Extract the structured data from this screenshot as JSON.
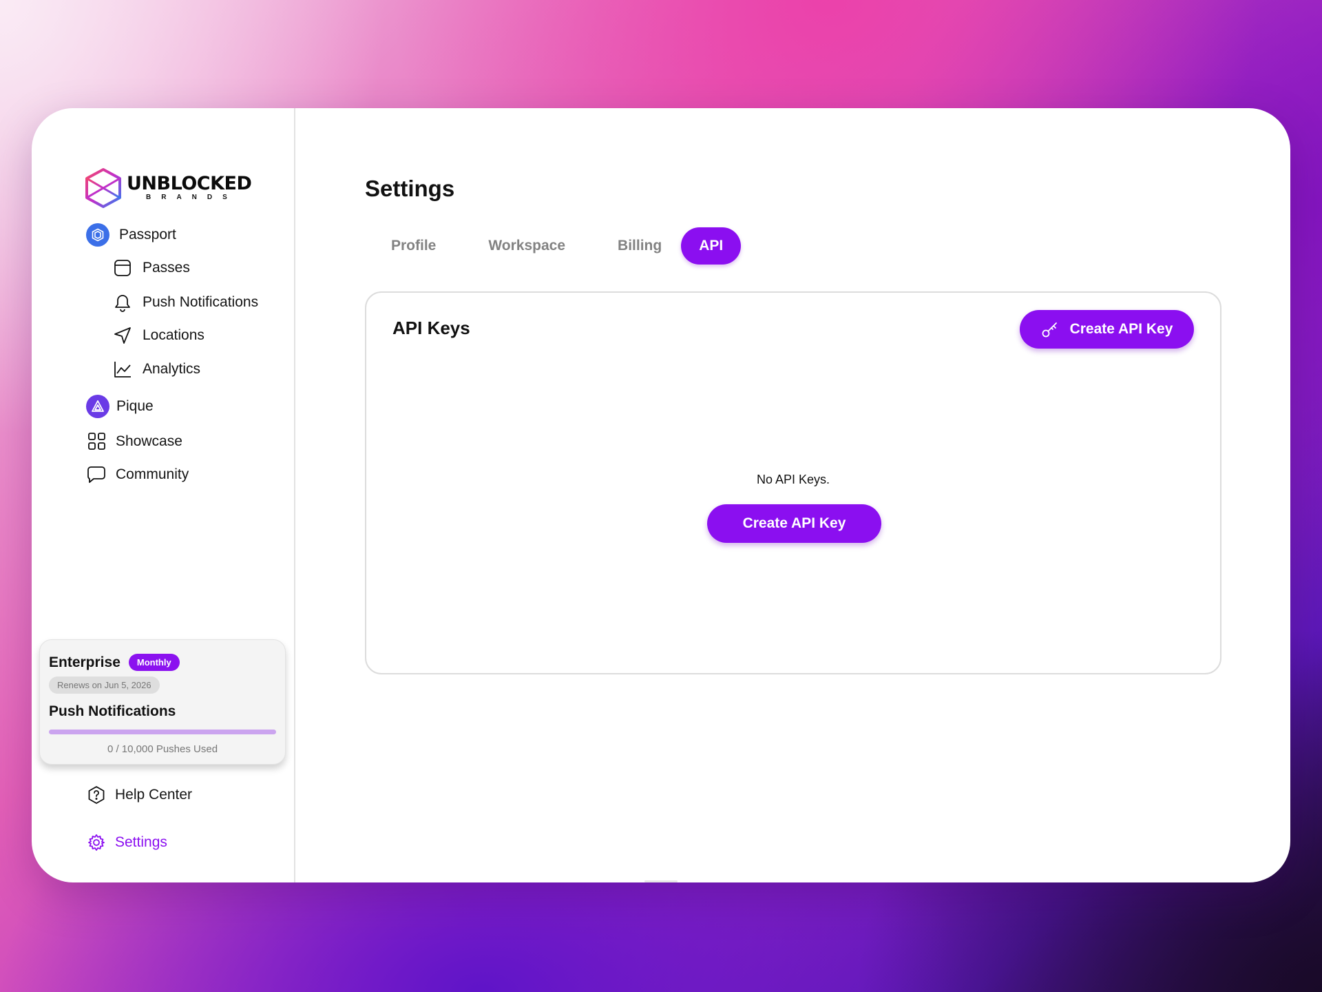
{
  "brand": {
    "name": "UNBLOCKED",
    "subtitle": "BRANDS"
  },
  "sidebar": {
    "items": [
      {
        "label": "Passport",
        "icon": "passport-icon"
      },
      {
        "label": "Passes",
        "icon": "passes-icon"
      },
      {
        "label": "Push Notifications",
        "icon": "bell-icon"
      },
      {
        "label": "Locations",
        "icon": "navigation-arrow-icon"
      },
      {
        "label": "Analytics",
        "icon": "line-chart-icon"
      },
      {
        "label": "Pique",
        "icon": "pique-icon"
      },
      {
        "label": "Showcase",
        "icon": "grid-icon"
      },
      {
        "label": "Community",
        "icon": "chat-bubble-icon"
      }
    ],
    "footer": {
      "help": {
        "label": "Help Center",
        "icon": "help-hexagon-icon"
      },
      "settings": {
        "label": "Settings",
        "icon": "gear-icon",
        "active_color": "#8b0ff0"
      }
    }
  },
  "plan": {
    "name": "Enterprise",
    "badge": "Monthly",
    "renews": "Renews on Jun 5, 2026",
    "usage_title": "Push Notifications",
    "usage_text": "0 / 10,000 Pushes Used",
    "used": 0,
    "limit": 10000
  },
  "main": {
    "title": "Settings",
    "tabs": [
      {
        "label": "Profile",
        "active": false
      },
      {
        "label": "Workspace",
        "active": false
      },
      {
        "label": "Billing",
        "active": false
      },
      {
        "label": "API",
        "active": true
      }
    ],
    "card": {
      "title": "API Keys",
      "header_button": "Create API Key",
      "empty_text": "No API Keys.",
      "empty_button": "Create API Key"
    }
  },
  "colors": {
    "accent": "#8b0ff0",
    "passport": "#3b6fe8",
    "pique": "#6a3be6"
  }
}
